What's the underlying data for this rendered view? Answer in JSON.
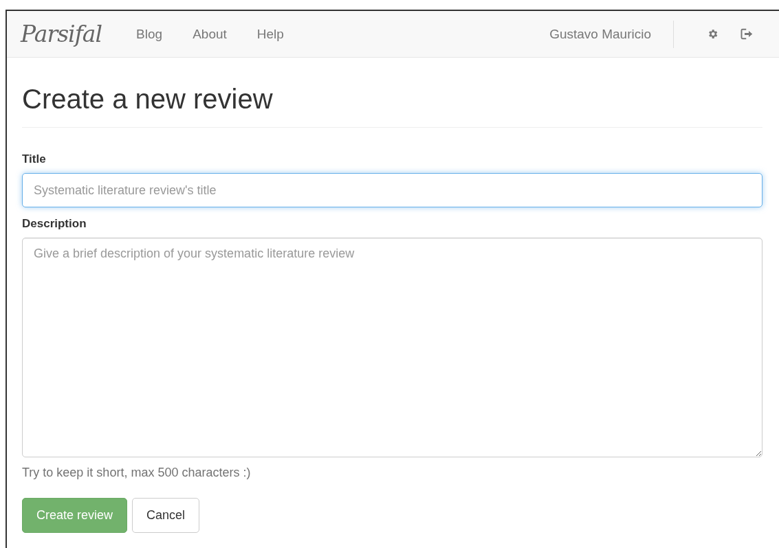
{
  "navbar": {
    "brand": "Parsifal",
    "links": [
      "Blog",
      "About",
      "Help"
    ],
    "user": "Gustavo Mauricio"
  },
  "heading": "Create a new review",
  "form": {
    "fields": [
      {
        "kind": "input",
        "label": "Title",
        "placeholder": "Systematic literature review's title",
        "focused": true
      },
      {
        "kind": "textarea",
        "label": "Description",
        "placeholder": "Give a brief description of your systematic literature review",
        "focused": false
      }
    ],
    "help": "Try to keep it short, max 500 characters :)",
    "buttons": [
      {
        "kind": "primary",
        "label": "Create review"
      },
      {
        "kind": "default",
        "label": "Cancel"
      }
    ]
  }
}
